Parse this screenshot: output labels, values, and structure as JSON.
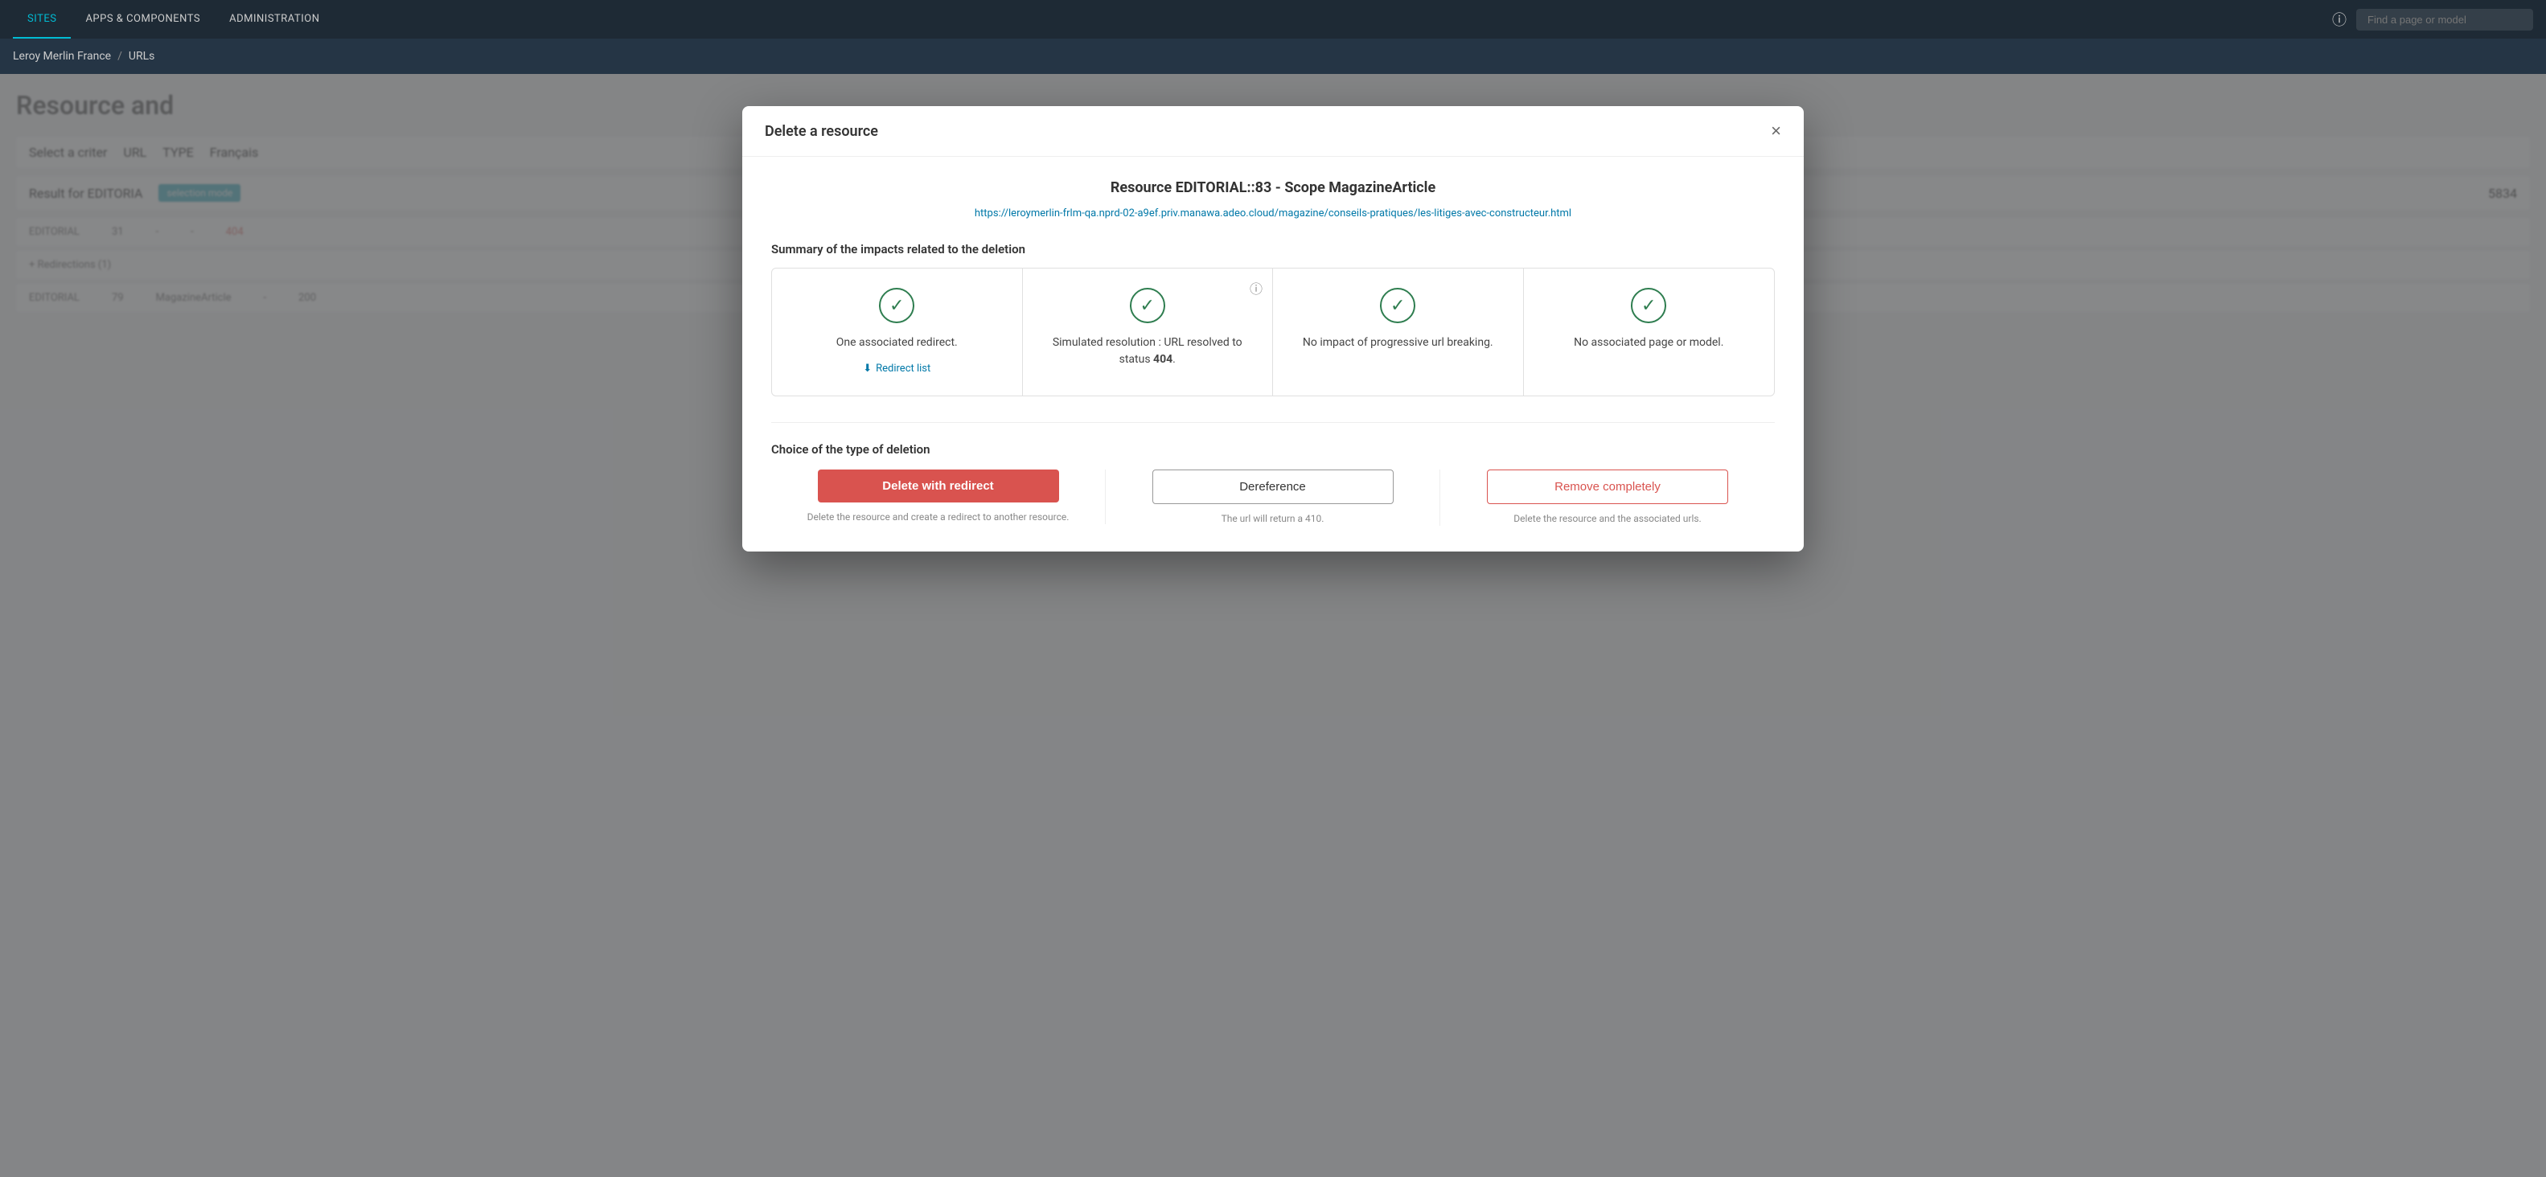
{
  "nav": {
    "sites_label": "SITES",
    "apps_label": "APPS & COMPONENTS",
    "admin_label": "ADMINISTRATION",
    "search_placeholder": "Find a page or model"
  },
  "breadcrumb": {
    "site": "Leroy Merlin France",
    "section": "URLs"
  },
  "background": {
    "title": "Resource and",
    "select_label": "Select a criter",
    "url_label": "URL",
    "type_label": "TYPE",
    "lang_label": "Français",
    "result_label": "Result for EDITORIA",
    "selection_mode": "selection mode",
    "count": "5834",
    "redirect_list": "Redirect list",
    "rows": [
      {
        "type": "EDITORIAL",
        "id": "31",
        "col2": "-",
        "col3": "-",
        "status": "404"
      },
      {
        "type": "Redirections (1)",
        "id": "",
        "col2": "",
        "col3": "",
        "status": ""
      },
      {
        "type": "EDITORIAL",
        "id": "79",
        "col2": "MagazineArticle",
        "col3": "-",
        "status": "200"
      }
    ]
  },
  "modal": {
    "title": "Delete a resource",
    "close_label": "×",
    "resource_name": "Resource EDITORIAL::83 - Scope MagazineArticle",
    "resource_url": "https://leroymerlin-frlm-qa.nprd-02-a9ef.priv.manawa.adeo.cloud/magazine/conseils-pratiques/les-litiges-avec-constructeur.html",
    "impacts_heading": "Summary of the impacts related to the deletion",
    "impact_cells": [
      {
        "id": "redirect",
        "check": true,
        "text": "One associated redirect.",
        "link": "Redirect list",
        "has_info": false
      },
      {
        "id": "resolution",
        "check": true,
        "text": "Simulated resolution :  URL resolved to status 404.",
        "bold_text": "404",
        "link": null,
        "has_info": true
      },
      {
        "id": "progressive",
        "check": true,
        "text": "No impact of progressive url breaking.",
        "link": null,
        "has_info": false
      },
      {
        "id": "page_model",
        "check": true,
        "text": "No associated page or model.",
        "link": null,
        "has_info": false
      }
    ],
    "deletion_heading": "Choice of the type of deletion",
    "buttons": {
      "delete_redirect": "Delete with redirect",
      "delete_redirect_hint": "Delete the resource and create a redirect to another resource.",
      "dereference": "Dereference",
      "dereference_hint": "The url will return a 410.",
      "remove_completely": "Remove completely",
      "remove_completely_hint": "Delete the resource and the associated urls."
    }
  }
}
